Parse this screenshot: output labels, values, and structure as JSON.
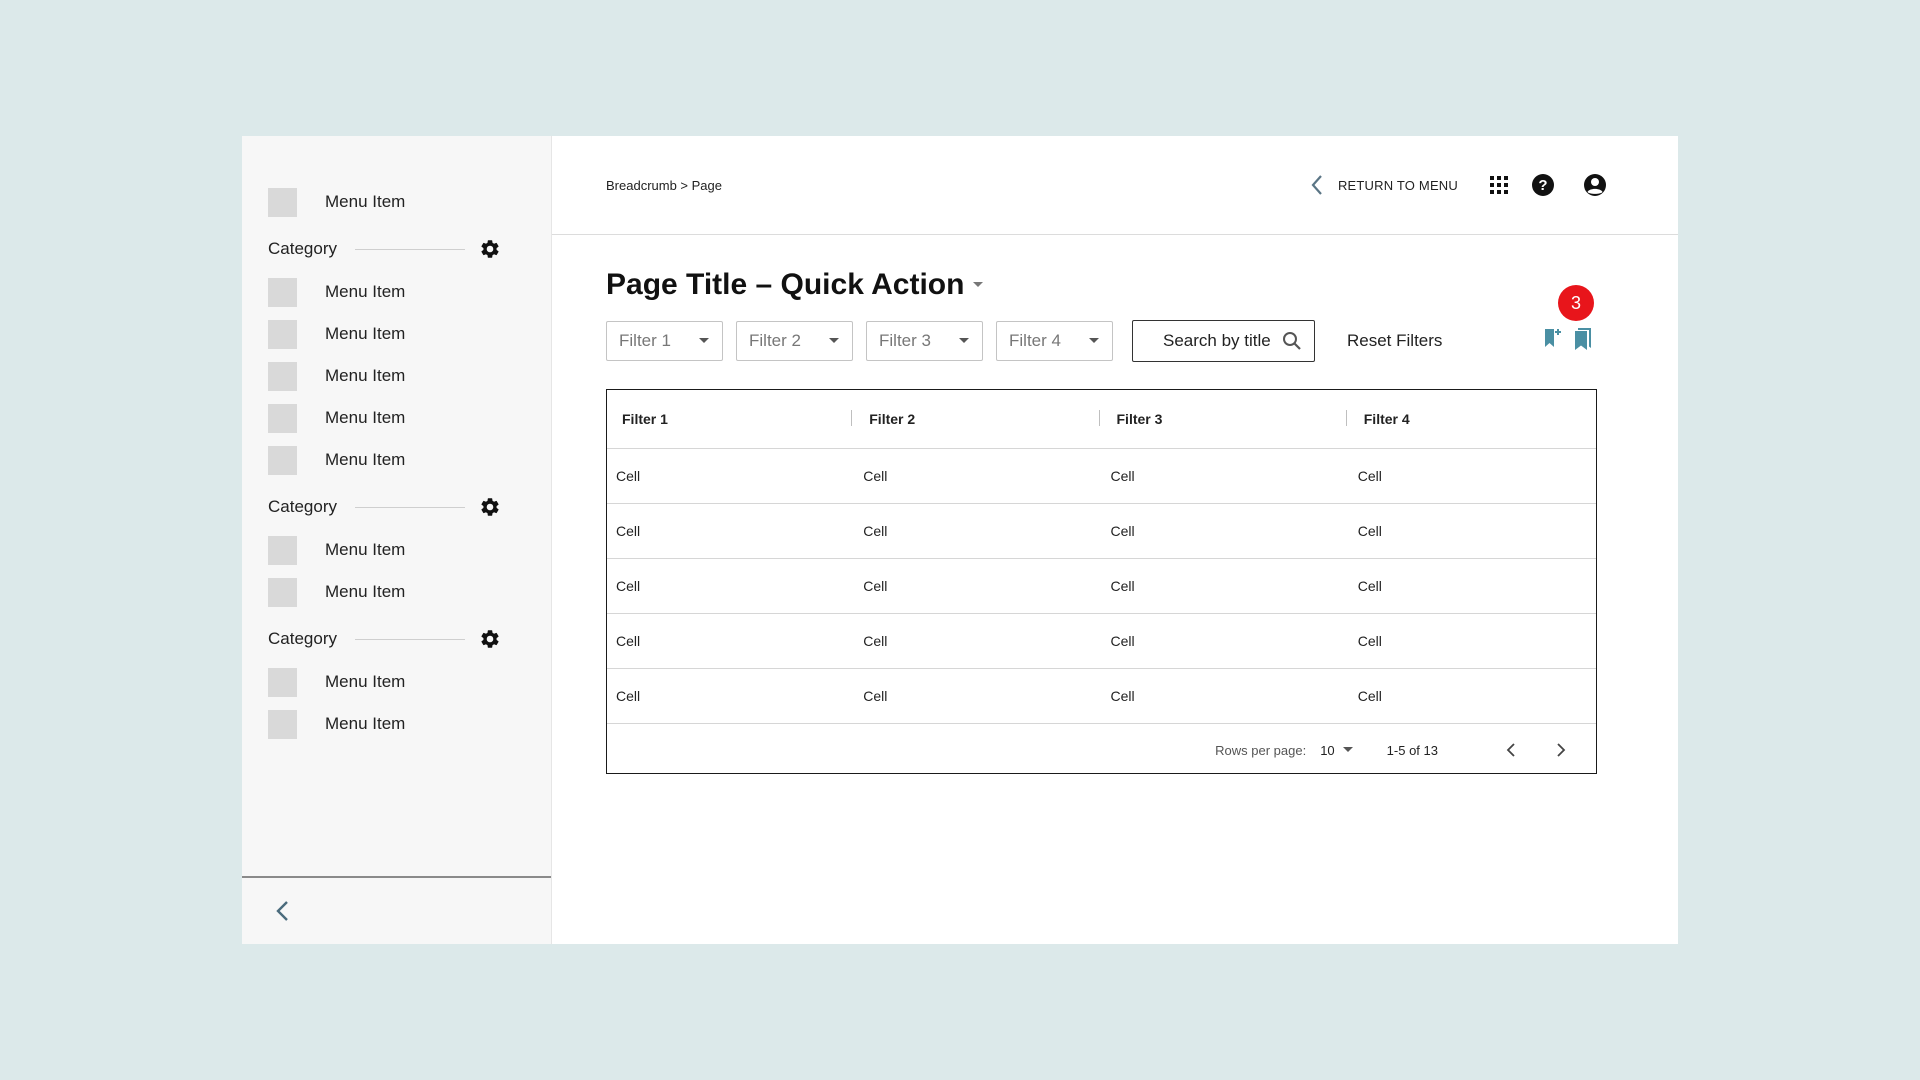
{
  "sidebar": {
    "top_item": {
      "label": "Menu Item"
    },
    "sections": [
      {
        "category": "Category",
        "items": [
          "Menu Item",
          "Menu Item",
          "Menu Item",
          "Menu Item",
          "Menu Item"
        ]
      },
      {
        "category": "Category",
        "items": [
          "Menu Item",
          "Menu Item"
        ]
      },
      {
        "category": "Category",
        "items": [
          "Menu Item",
          "Menu Item"
        ]
      }
    ],
    "collapse_icon": "chevron-left-icon"
  },
  "header": {
    "breadcrumb": "Breadcrumb > Page",
    "return_label": "RETURN TO MENU",
    "icons": [
      "apps-grid-icon",
      "help-icon",
      "account-icon"
    ]
  },
  "page": {
    "title": "Page Title – Quick Action"
  },
  "filters": {
    "items": [
      "Filter 1",
      "Filter 2",
      "Filter 3",
      "Filter 4"
    ],
    "search_label": "Search by title",
    "reset_label": "Reset Filters",
    "badge_count": "3"
  },
  "table": {
    "columns": [
      "Filter 1",
      "Filter 2",
      "Filter 3",
      "Filter 4"
    ],
    "rows": [
      [
        "Cell",
        "Cell",
        "Cell",
        "Cell"
      ],
      [
        "Cell",
        "Cell",
        "Cell",
        "Cell"
      ],
      [
        "Cell",
        "Cell",
        "Cell",
        "Cell"
      ],
      [
        "Cell",
        "Cell",
        "Cell",
        "Cell"
      ],
      [
        "Cell",
        "Cell",
        "Cell",
        "Cell"
      ]
    ],
    "footer": {
      "rows_per_page_label": "Rows per page:",
      "rows_per_page_value": "10",
      "range": "1-5 of 13"
    }
  },
  "colors": {
    "background": "#dce9ea",
    "badge": "#e8151b",
    "bookmark": "#4a8fa3"
  }
}
